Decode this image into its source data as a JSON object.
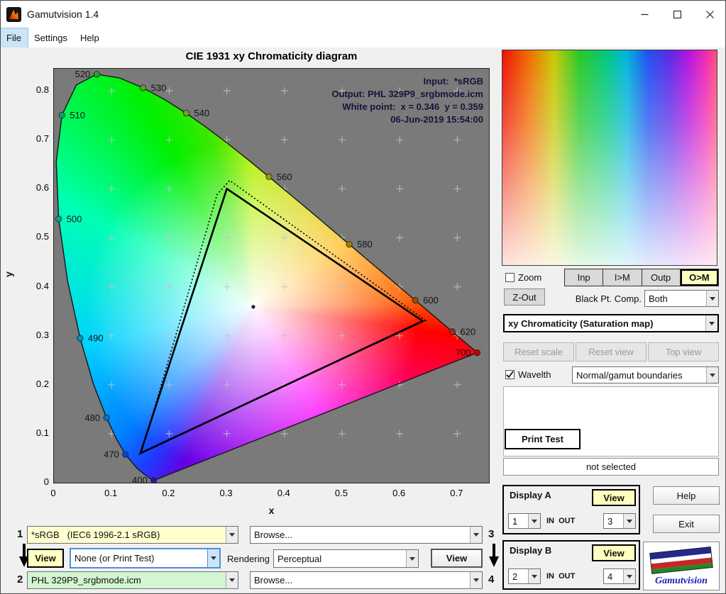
{
  "window": {
    "title": "Gamutvision 1.4"
  },
  "menu": {
    "items": [
      {
        "label": "File"
      },
      {
        "label": "Settings"
      },
      {
        "label": "Help"
      }
    ]
  },
  "chart_data": {
    "type": "scatter",
    "title": "CIE 1931 xy Chromaticity diagram",
    "xlabel": "x",
    "ylabel": "y",
    "xlim": [
      0,
      0.755
    ],
    "ylim": [
      0,
      0.845
    ],
    "x_ticks": [
      0,
      0.1,
      0.2,
      0.3,
      0.4,
      0.5,
      0.6,
      0.7
    ],
    "y_ticks": [
      0,
      0.1,
      0.2,
      0.3,
      0.4,
      0.5,
      0.6,
      0.7,
      0.8
    ],
    "grid": "plus-marks at 0.1 spacing",
    "annotations": {
      "lines": [
        "Input:  *sRGB",
        "Output: PHL 329P9_srgbmode.icm",
        "White point:  x = 0.346  y = 0.359",
        "06-Jun-2019 15:54:00"
      ],
      "color": "#14143c"
    },
    "white_point": {
      "x": 0.346,
      "y": 0.359
    },
    "srgb_triangle": [
      [
        0.64,
        0.33
      ],
      [
        0.3,
        0.6
      ],
      [
        0.15,
        0.06
      ]
    ],
    "output_gamut_dotted": [
      [
        0.645,
        0.331
      ],
      [
        0.305,
        0.617
      ],
      [
        0.283,
        0.588
      ],
      [
        0.152,
        0.062
      ]
    ],
    "wavelength_markers": [
      {
        "label": "520",
        "x": 0.0743,
        "y": 0.8338,
        "color": "#28a428",
        "side": "left"
      },
      {
        "label": "530",
        "x": 0.1547,
        "y": 0.8059,
        "color": "#55a522",
        "side": "right"
      },
      {
        "label": "540",
        "x": 0.2296,
        "y": 0.7543,
        "color": "#7aa018",
        "side": "right"
      },
      {
        "label": "560",
        "x": 0.3731,
        "y": 0.6245,
        "color": "#99980e",
        "side": "right"
      },
      {
        "label": "580",
        "x": 0.5125,
        "y": 0.4866,
        "color": "#a67c00",
        "side": "right"
      },
      {
        "label": "600",
        "x": 0.627,
        "y": 0.3725,
        "color": "#a54a00",
        "side": "right"
      },
      {
        "label": "620",
        "x": 0.6915,
        "y": 0.3083,
        "color": "#a82a10",
        "side": "right"
      },
      {
        "label": "700",
        "x": 0.7347,
        "y": 0.2653,
        "color": "#c00000",
        "side": "left"
      },
      {
        "label": "510",
        "x": 0.0139,
        "y": 0.7502,
        "color": "#00a85a",
        "side": "right"
      },
      {
        "label": "500",
        "x": 0.0082,
        "y": 0.5384,
        "color": "#00a487",
        "side": "right"
      },
      {
        "label": "490",
        "x": 0.0454,
        "y": 0.295,
        "color": "#0095b4",
        "side": "right"
      },
      {
        "label": "480",
        "x": 0.0913,
        "y": 0.1327,
        "color": "#0073d2",
        "side": "left"
      },
      {
        "label": "470",
        "x": 0.1241,
        "y": 0.0578,
        "color": "#0046e6",
        "side": "left"
      },
      {
        "label": "400",
        "x": 0.1733,
        "y": 0.0048,
        "color": "#1c1ca0",
        "side": "left"
      }
    ],
    "spectral_locus": [
      [
        0.1741,
        0.005
      ],
      [
        0.1738,
        0.0049
      ],
      [
        0.1733,
        0.0048
      ],
      [
        0.1726,
        0.0048
      ],
      [
        0.1714,
        0.0051
      ],
      [
        0.1689,
        0.0069
      ],
      [
        0.1644,
        0.0109
      ],
      [
        0.1566,
        0.0177
      ],
      [
        0.144,
        0.0297
      ],
      [
        0.1241,
        0.0578
      ],
      [
        0.1096,
        0.0868
      ],
      [
        0.0913,
        0.1327
      ],
      [
        0.0687,
        0.2007
      ],
      [
        0.0454,
        0.295
      ],
      [
        0.0235,
        0.4127
      ],
      [
        0.0082,
        0.5384
      ],
      [
        0.0039,
        0.6548
      ],
      [
        0.0139,
        0.7502
      ],
      [
        0.0389,
        0.812
      ],
      [
        0.0743,
        0.8338
      ],
      [
        0.1142,
        0.8262
      ],
      [
        0.1547,
        0.8059
      ],
      [
        0.1929,
        0.7816
      ],
      [
        0.2296,
        0.7543
      ],
      [
        0.2658,
        0.7243
      ],
      [
        0.3016,
        0.6923
      ],
      [
        0.3373,
        0.6589
      ],
      [
        0.3731,
        0.6245
      ],
      [
        0.4087,
        0.5896
      ],
      [
        0.4441,
        0.5547
      ],
      [
        0.4788,
        0.5202
      ],
      [
        0.5125,
        0.4866
      ],
      [
        0.5448,
        0.4544
      ],
      [
        0.5752,
        0.4242
      ],
      [
        0.6029,
        0.3965
      ],
      [
        0.627,
        0.3725
      ],
      [
        0.6482,
        0.3514
      ],
      [
        0.6658,
        0.334
      ],
      [
        0.6915,
        0.3083
      ],
      [
        0.7079,
        0.292
      ],
      [
        0.719,
        0.2809
      ],
      [
        0.726,
        0.274
      ],
      [
        0.7347,
        0.2653
      ]
    ]
  },
  "right_panel": {
    "zoom_label": "Zoom",
    "seg_buttons": [
      "Inp",
      "I>M",
      "Outp",
      "O>M"
    ],
    "seg_active": "O>M",
    "zout_label": "Z-Out",
    "black_pt_label": "Black Pt. Comp.",
    "black_pt_value": "Both",
    "mode_value": "xy Chromaticity (Saturation map)",
    "reset_scale_label": "Reset scale",
    "reset_view_label": "Reset view",
    "top_view_label": "Top view",
    "wavelth_label": "Wavelth",
    "boundary_value": "Normal/gamut boundaries",
    "print_test_label": "Print Test",
    "status_text": "not selected",
    "display_a": {
      "title": "Display A",
      "view_label": "View",
      "in_value": "1",
      "inout_label": "IN  OUT",
      "out_value": "3"
    },
    "display_b": {
      "title": "Display B",
      "view_label": "View",
      "in_value": "2",
      "inout_label": "IN  OUT",
      "out_value": "4"
    },
    "help_label": "Help",
    "exit_label": "Exit",
    "logo_text": "Gamutvision"
  },
  "bottom": {
    "row1_num": "1",
    "row1_value": "*sRGB   (IEC6 1996-2.1 sRGB)",
    "row1_browse": "Browse...",
    "row1_num_right": "3",
    "view_a_label": "View",
    "print_select_value": "None (or Print Test)",
    "rendering_label": "Rendering",
    "intent_value": "Perceptual",
    "view_b_label": "View",
    "row2_num": "2",
    "row2_value": "PHL 329P9_srgbmode.icm",
    "row2_browse": "Browse...",
    "row2_num_right": "4"
  },
  "colors": {
    "accent_yellow": "#ffffc0",
    "combo_yellow": "#ffffd0",
    "combo_green": "#d2f5d2",
    "focus_blue": "#4a90d9",
    "plot_background": "#7a7a7a"
  }
}
